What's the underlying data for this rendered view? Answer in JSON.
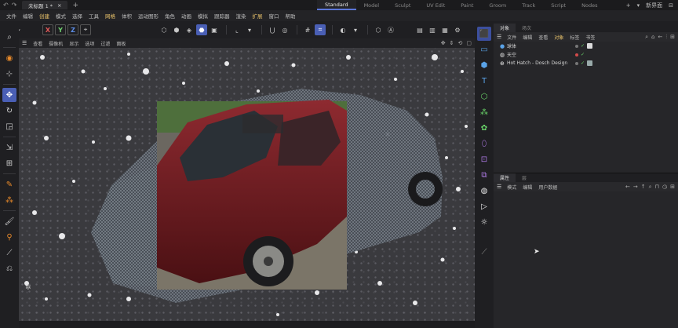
{
  "titlebar": {
    "doc_title": "未标题 1 *",
    "doc_close": "×",
    "new_tab": "+",
    "layouts": [
      "Standard",
      "Model",
      "Sculpt",
      "UV Edit",
      "Paint",
      "Groom",
      "Track",
      "Script",
      "Nodes"
    ],
    "active_layout": "Standard",
    "add_layout": "+",
    "new_ui": "新界面"
  },
  "menubar": {
    "items": [
      "文件",
      "编辑",
      "创建",
      "模式",
      "选择",
      "工具",
      "网格",
      "体积",
      "运动图形",
      "角色",
      "动画",
      "模拟",
      "跟踪器",
      "渲染",
      "扩展",
      "窗口",
      "帮助"
    ],
    "highlighted": [
      "创建",
      "网格",
      "扩展"
    ]
  },
  "toolbar": {
    "axes": [
      "X",
      "Y",
      "Z"
    ]
  },
  "viewport": {
    "menu": [
      "查看",
      "摄像机",
      "显示",
      "选项",
      "过滤",
      "面板"
    ]
  },
  "object_panel": {
    "tabs": [
      "对象",
      "场次"
    ],
    "menu": [
      "文件",
      "编辑",
      "查看",
      "对象",
      "标签",
      "书签"
    ],
    "active_menu": "对象",
    "objects": [
      {
        "name": "球体",
        "icon": "sphere-icon"
      },
      {
        "name": "天空",
        "icon": "sky-icon"
      },
      {
        "name": "Hot Hatch - Dosch Design",
        "icon": "null-object-icon"
      }
    ]
  },
  "attribute_panel": {
    "tabs": [
      "属性",
      "层"
    ],
    "menu": [
      "模式",
      "编辑",
      "用户数据"
    ]
  }
}
